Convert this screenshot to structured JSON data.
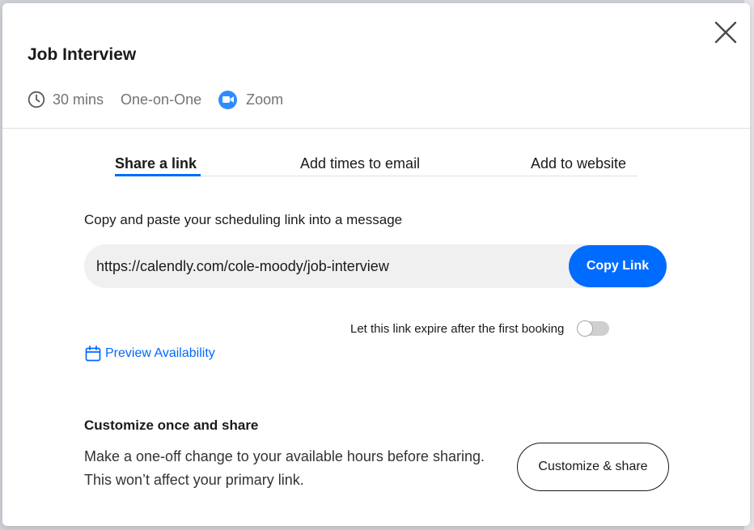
{
  "modal": {
    "title": "Job Interview",
    "duration": "30 mins",
    "event_kind": "One-on-One",
    "location": "Zoom"
  },
  "tabs": [
    {
      "label": "Share a link",
      "active": true
    },
    {
      "label": "Add times to email",
      "active": false
    },
    {
      "label": "Add to website",
      "active": false
    }
  ],
  "share": {
    "instruction": "Copy and paste your scheduling link into a message",
    "link": "https://calendly.com/cole-moody/job-interview",
    "copy_button": "Copy Link",
    "expire_label": "Let this link expire after the first booking",
    "expire_enabled": false,
    "preview_label": "Preview Availability"
  },
  "customize": {
    "title": "Customize once and share",
    "description": "Make a one-off change to your available hours before sharing. This won’t affect your primary link.",
    "button": "Customize & share"
  },
  "colors": {
    "accent": "#006bff",
    "zoom": "#2d8cff",
    "link": "#0069ff"
  },
  "icons": [
    "close-icon",
    "clock-icon",
    "zoom-camera-icon",
    "calendar-icon"
  ]
}
